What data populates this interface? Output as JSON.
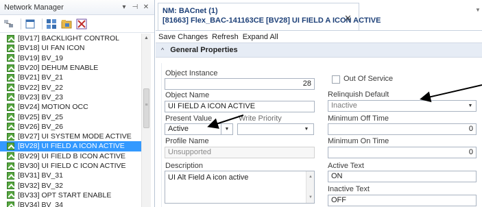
{
  "left_panel": {
    "title": "Network Manager",
    "controls": {
      "pin": "▾",
      "autohide": "⊣",
      "close": "✕"
    },
    "tree_items": [
      {
        "label": "[BV17] BACKLIGHT CONTROL",
        "selected": false
      },
      {
        "label": "[BV18] UI FAN ICON",
        "selected": false
      },
      {
        "label": "[BV19] BV_19",
        "selected": false
      },
      {
        "label": "[BV20] DEHUM ENABLE",
        "selected": false
      },
      {
        "label": "[BV21] BV_21",
        "selected": false
      },
      {
        "label": "[BV22] BV_22",
        "selected": false
      },
      {
        "label": "[BV23] BV_23",
        "selected": false
      },
      {
        "label": "[BV24] MOTION OCC",
        "selected": false
      },
      {
        "label": "[BV25] BV_25",
        "selected": false
      },
      {
        "label": "[BV26] BV_26",
        "selected": false
      },
      {
        "label": "[BV27] UI SYSTEM MODE ACTIVE",
        "selected": false
      },
      {
        "label": "[BV28] UI FIELD A ICON ACTIVE",
        "selected": true
      },
      {
        "label": "[BV29] UI FIELD B ICON ACTIVE",
        "selected": false
      },
      {
        "label": "[BV30] UI FIELD C ICON ACTIVE",
        "selected": false
      },
      {
        "label": "[BV31] BV_31",
        "selected": false
      },
      {
        "label": "[BV32] BV_32",
        "selected": false
      },
      {
        "label": "[BV33] OPT START ENABLE",
        "selected": false
      },
      {
        "label": "[BV34] BV_34",
        "selected": false
      }
    ]
  },
  "document": {
    "tab_line1": "NM: BACnet (1)",
    "tab_line2": "[81663] Flex_BAC-141163CE [BV28] UI FIELD A ICON ACTIVE",
    "close": "✕",
    "commands": [
      "Save Changes",
      "Refresh",
      "Expand All"
    ],
    "section_title": "General Properties",
    "fields": {
      "object_instance": {
        "label": "Object Instance",
        "value": "28"
      },
      "out_of_service": {
        "label": "Out Of Service",
        "checked": false
      },
      "object_name": {
        "label": "Object Name",
        "value": "UI FIELD A ICON ACTIVE"
      },
      "relinquish_default": {
        "label": "Relinquish Default",
        "value": "Inactive"
      },
      "present_value": {
        "label": "Present Value",
        "value": "Active"
      },
      "write_priority": {
        "label": "Write Priority",
        "value": ""
      },
      "min_off_time": {
        "label": "Minimum Off Time",
        "value": "0"
      },
      "profile_name": {
        "label": "Profile Name",
        "value": "Unsupported"
      },
      "min_on_time": {
        "label": "Minimum On Time",
        "value": "0"
      },
      "description": {
        "label": "Description",
        "value": "UI Alt Field A icon active"
      },
      "active_text": {
        "label": "Active Text",
        "value": "ON"
      },
      "inactive_text": {
        "label": "Inactive Text",
        "value": "OFF"
      }
    }
  },
  "colors": {
    "selection": "#3399ff",
    "title_text": "#1c3f77",
    "section_bg": "#e6ecf5",
    "annotation_arrow": "#000000"
  }
}
